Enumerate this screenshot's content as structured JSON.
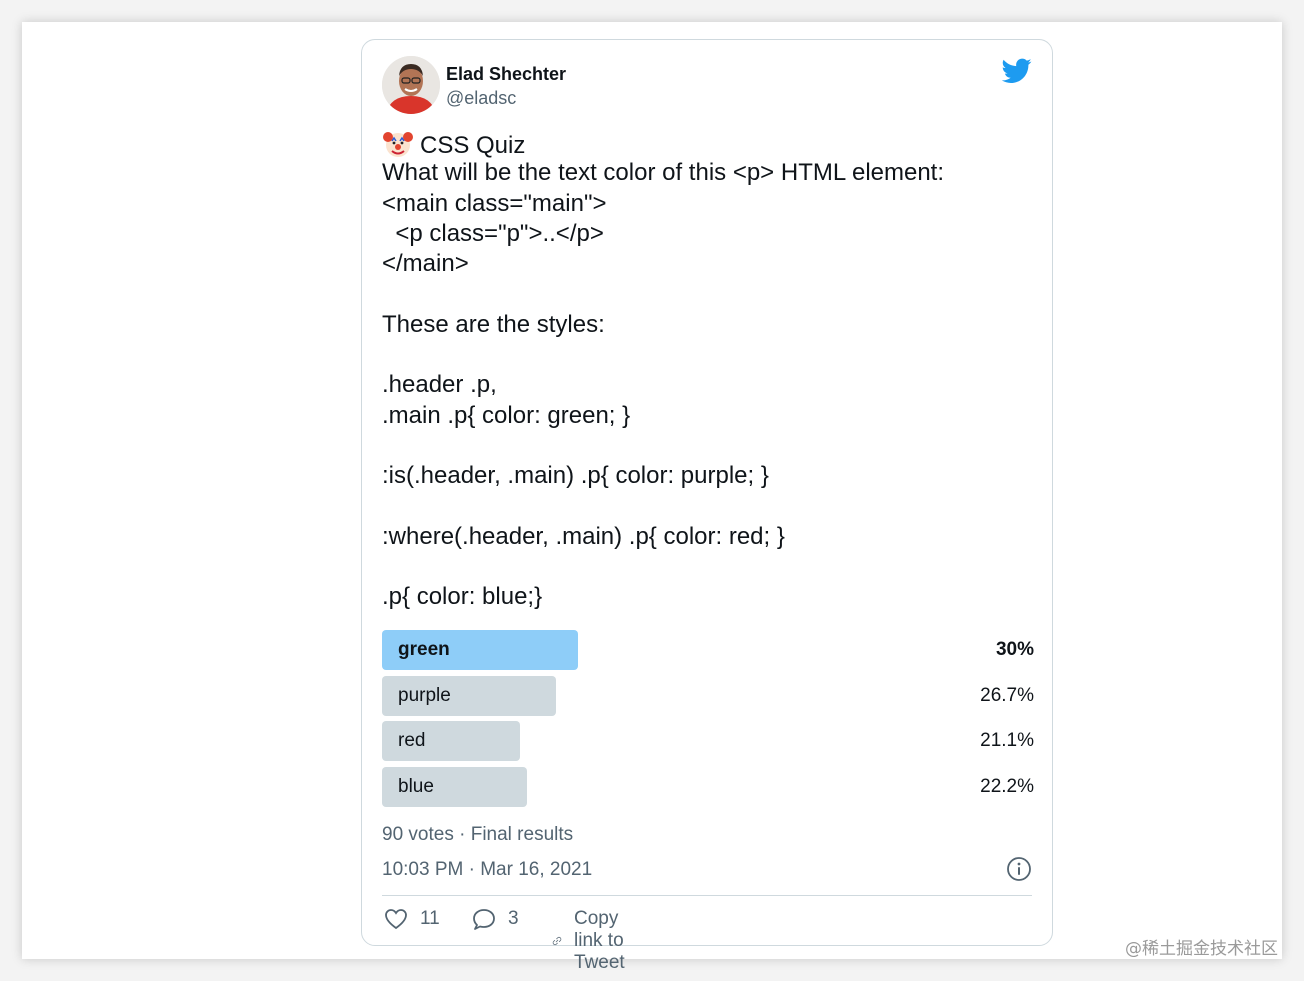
{
  "tweet": {
    "author_name": "Elad Shechter",
    "author_handle": "@eladsc",
    "lines": [
      "CSS Quiz",
      "What will be the text color of this <p> HTML element:",
      "<main class=\"main\">",
      "  <p class=\"p\">..</p>",
      "</main>",
      "",
      "These are the styles:",
      "",
      ".header .p,",
      ".main .p{ color: green; }",
      "",
      ":is(.header, .main) .p{ color: purple; }",
      "",
      ":where(.header, .main) .p{ color: red; }",
      "",
      ".p{ color: blue;}"
    ],
    "poll": {
      "options": [
        {
          "label": "green",
          "percent": "30%",
          "fraction": 0.3,
          "winner": true
        },
        {
          "label": "purple",
          "percent": "26.7%",
          "fraction": 0.267,
          "winner": false
        },
        {
          "label": "red",
          "percent": "21.1%",
          "fraction": 0.211,
          "winner": false
        },
        {
          "label": "blue",
          "percent": "22.2%",
          "fraction": 0.222,
          "winner": false
        }
      ],
      "summary": "90 votes · Final results"
    },
    "timestamp": "10:03 PM · Mar 16, 2021",
    "actions": {
      "likes": "11",
      "replies": "3",
      "copy_link_label": "Copy link to Tweet"
    }
  },
  "colors": {
    "accent": "#1d9bf0",
    "winner_bar": "#8ecdf8",
    "bar": "#cfd9de",
    "muted_text": "#536471"
  },
  "watermark": "@稀土掘金技术社区"
}
